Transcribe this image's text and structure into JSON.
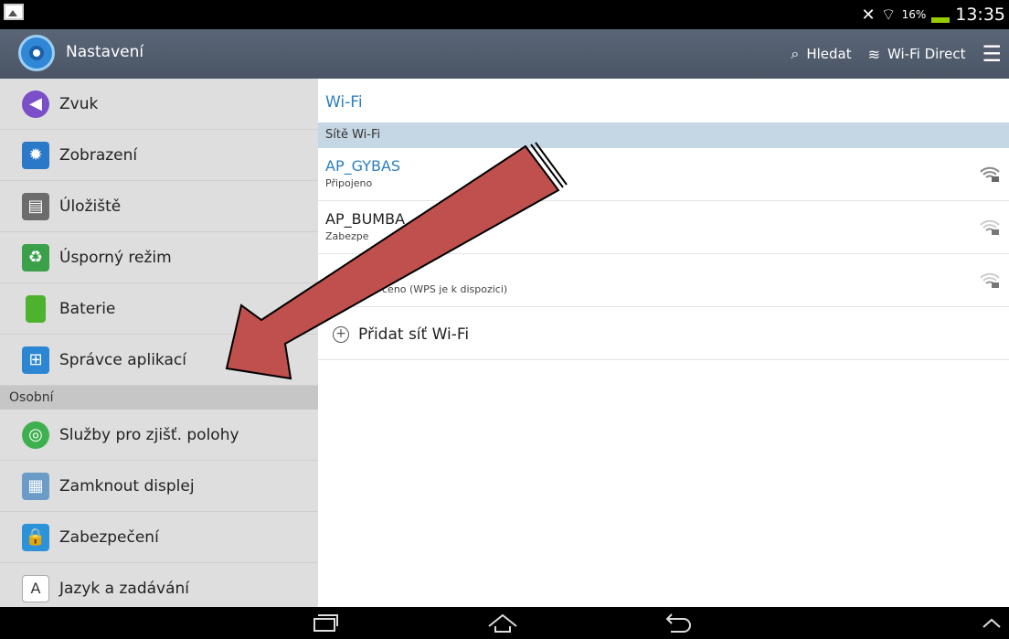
{
  "status_bar": {
    "battery": "16%",
    "time": "13:35"
  },
  "action_bar": {
    "title": "Nastavení",
    "actions": [
      {
        "label": "Hledat",
        "icon": "search-icon"
      },
      {
        "label": "Wi-Fi Direct",
        "icon": "wifi-direct-icon"
      }
    ]
  },
  "sidebar": {
    "items_top": [
      {
        "label": "Zvuk",
        "icon": "sound-icon"
      },
      {
        "label": "Zobrazení",
        "icon": "display-icon"
      },
      {
        "label": "Úložiště",
        "icon": "storage-icon"
      },
      {
        "label": "Úsporný režim",
        "icon": "power-saving-icon"
      },
      {
        "label": "Baterie",
        "icon": "battery-icon"
      },
      {
        "label": "Správce aplikací",
        "icon": "app-manager-icon"
      }
    ],
    "section_personal": "Osobní",
    "items_personal": [
      {
        "label": "Služby pro zjišť. polohy",
        "icon": "location-icon"
      },
      {
        "label": "Zamknout displej",
        "icon": "lock-screen-icon"
      },
      {
        "label": "Zabezpečení",
        "icon": "security-icon"
      },
      {
        "label": "Jazyk a zadávání",
        "icon": "language-icon"
      }
    ]
  },
  "main": {
    "title": "Wi-Fi",
    "section_header": "Sítě Wi-Fi",
    "networks": [
      {
        "name": "AP_GYBAS",
        "status": "Připojeno",
        "icon": "wifi-locked-icon",
        "connected": true
      },
      {
        "name": "AP_BUMBA",
        "status": "Zabezpe",
        "icon": "wifi-locked-icon",
        "connected": false
      },
      {
        "name": "",
        "status": "čeno (WPS je k dispozici)",
        "icon": "wifi-locked-icon",
        "connected": false
      }
    ],
    "add_network_label": "Přidat síť Wi-Fi"
  },
  "colors": {
    "accent": "#2c7fbf",
    "action_bar": "#505c6d",
    "sidebar_bg": "#dedede",
    "arrow_fill": "#c0504d"
  }
}
